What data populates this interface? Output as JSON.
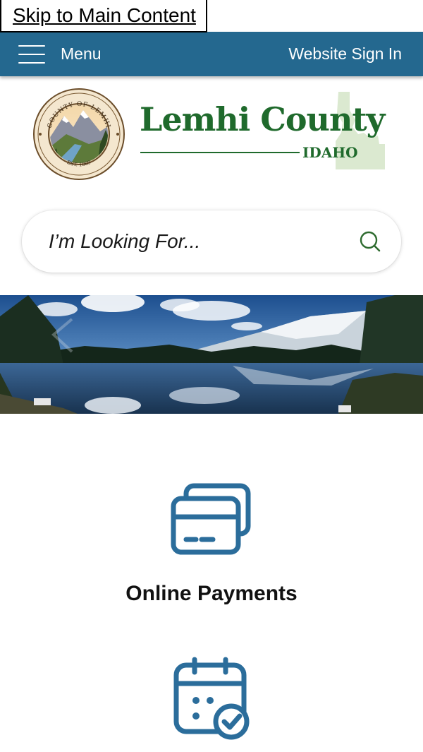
{
  "skip_link": {
    "label": "Skip to Main Content"
  },
  "topbar": {
    "menu_label": "Menu",
    "signin_label": "Website Sign In",
    "bg_color": "#24688f"
  },
  "logo": {
    "seal_top_text": "COUNTY OF LEMHI",
    "seal_bottom_text": "EST. 1869",
    "name": "Lemhi County",
    "state": "IDAHO",
    "brand_color": "#1f6a2c"
  },
  "search": {
    "placeholder": "I’m Looking For...",
    "value": "",
    "icon": "search-icon"
  },
  "banner": {
    "image": "mountain-lake-photo",
    "prev_icon": "chevron-left-icon",
    "next_icon": "chevron-right-icon"
  },
  "quick_links": [
    {
      "label": "Online Payments",
      "icon": "credit-cards-icon"
    },
    {
      "label": "",
      "icon": "calendar-check-icon"
    }
  ],
  "icon_color": "#2b6d9b"
}
